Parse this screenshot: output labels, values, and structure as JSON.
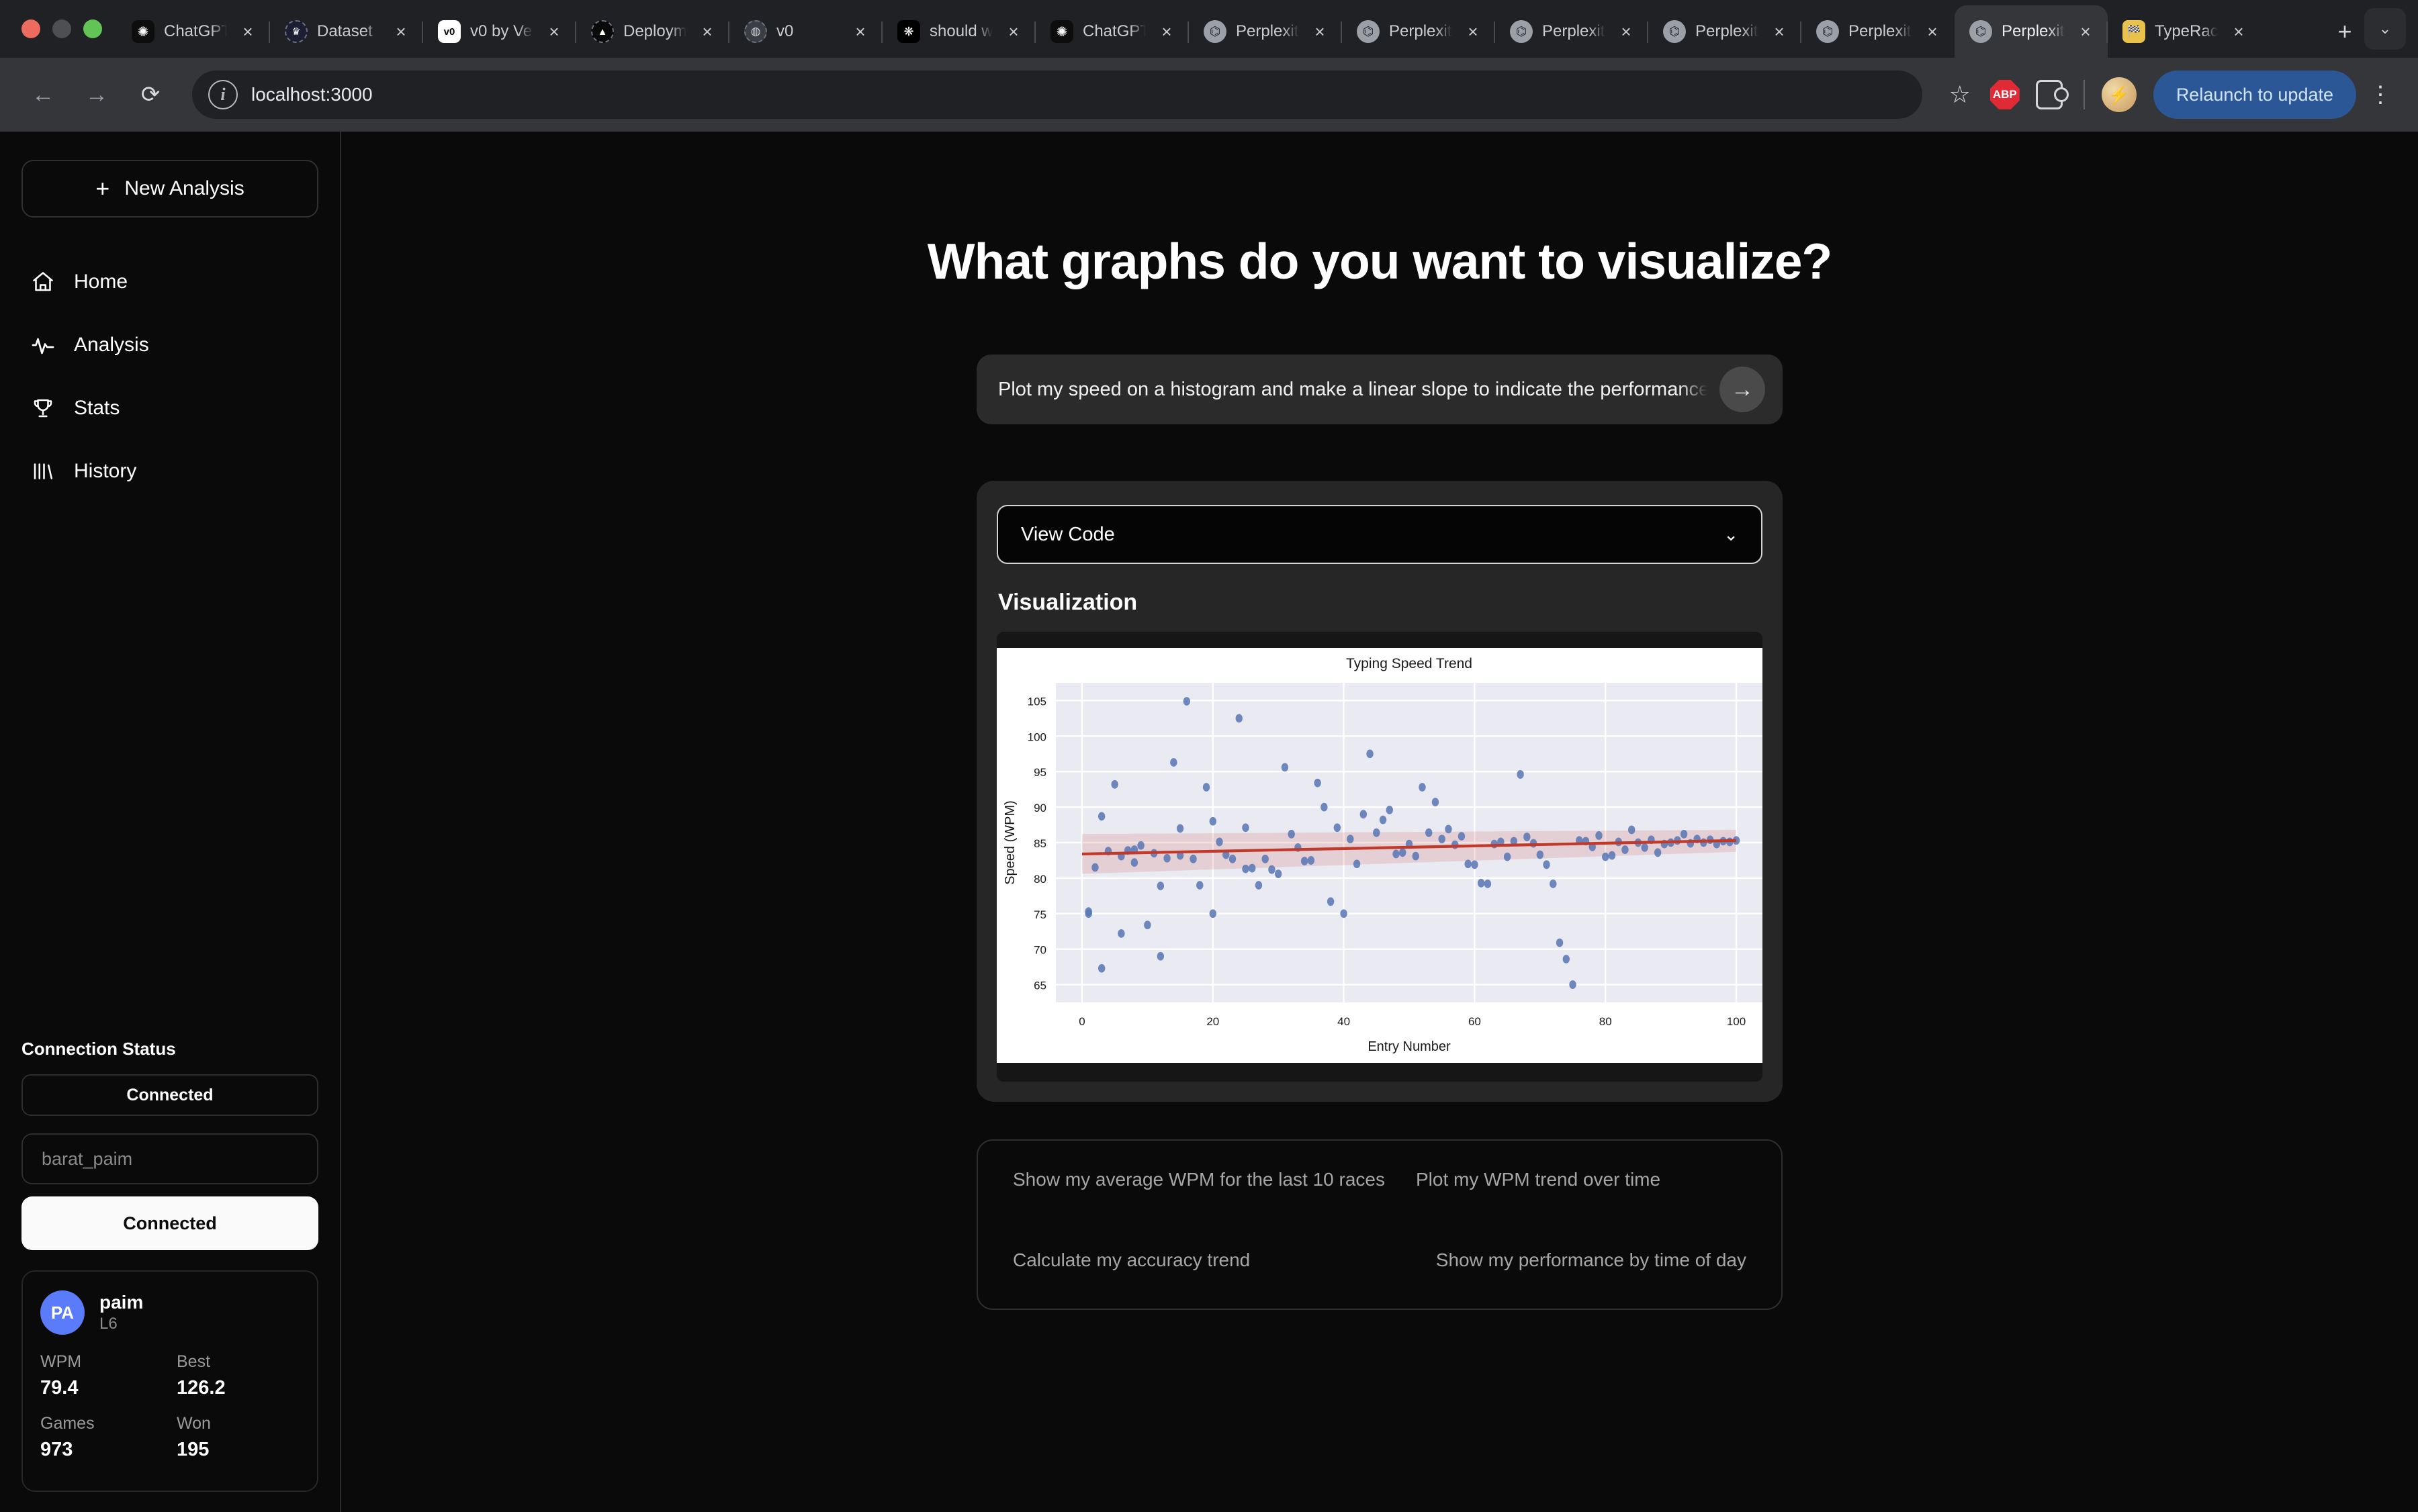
{
  "browser": {
    "tabs": [
      {
        "title": "ChatGPT",
        "favicon": "openai-icon",
        "active": false
      },
      {
        "title": "Dataset",
        "favicon": "crown-icon",
        "active": false
      },
      {
        "title": "v0 by Ve",
        "favicon": "v0-icon",
        "active": false
      },
      {
        "title": "Deploymen",
        "favicon": "vercel-icon",
        "active": false
      },
      {
        "title": "v0",
        "favicon": "globe-icon",
        "active": false
      },
      {
        "title": "should w",
        "favicon": "snowflake-icon",
        "active": false
      },
      {
        "title": "ChatGPT",
        "favicon": "openai-icon",
        "active": false
      },
      {
        "title": "Perplexity",
        "favicon": "perplexity-icon",
        "active": false
      },
      {
        "title": "Perplexity",
        "favicon": "perplexity-icon",
        "active": false
      },
      {
        "title": "Perplexity",
        "favicon": "perplexity-icon",
        "active": false
      },
      {
        "title": "Perplexity",
        "favicon": "perplexity-icon",
        "active": false
      },
      {
        "title": "Perplexity",
        "favicon": "perplexity-icon",
        "active": false
      },
      {
        "title": "Perplexity",
        "favicon": "perplexity-icon",
        "active": true
      },
      {
        "title": "TypeRace",
        "favicon": "typeracer-icon",
        "active": false
      }
    ],
    "new_tab_label": "+",
    "tab_list_label": "⌄",
    "toolbar": {
      "back_label": "←",
      "forward_label": "→",
      "reload_label": "⟳",
      "url": "localhost:3000",
      "site_info_label": "i",
      "bookmark_label": "☆",
      "adblock_label": "ABP",
      "relaunch_label": "Relaunch to update",
      "menu_label": "⋮"
    }
  },
  "sidebar": {
    "new_analysis_label": "New Analysis",
    "items": [
      {
        "label": "Home",
        "icon": "home-icon"
      },
      {
        "label": "Analysis",
        "icon": "activity-pulse-icon"
      },
      {
        "label": "Stats",
        "icon": "trophy-icon"
      },
      {
        "label": "History",
        "icon": "bar-chart-icon"
      }
    ],
    "connection": {
      "title": "Connection Status",
      "status_pill": "Connected",
      "username_placeholder": "barat_paim",
      "connect_button": "Connected"
    },
    "user": {
      "initials": "PA",
      "name": "paim",
      "level": "L6",
      "stats": [
        {
          "key": "WPM",
          "value": "79.4"
        },
        {
          "key": "Best",
          "value": "126.2"
        },
        {
          "key": "Games",
          "value": "973"
        },
        {
          "key": "Won",
          "value": "195"
        }
      ]
    }
  },
  "main": {
    "headline": "What graphs do you want to visualize?",
    "prompt_value": "Plot my speed on a histogram and make a linear slope to indicate the performance t",
    "send_label": "→",
    "view_code_label": "View Code",
    "view_code_chevron": "⌄",
    "visualization_label": "Visualization",
    "suggestions": [
      "Show my average WPM for the last 10 races",
      "Plot my WPM trend over time",
      "Calculate my accuracy trend",
      "Show my performance by time of day"
    ]
  },
  "chart_data": {
    "type": "scatter",
    "title": "Typing Speed Trend",
    "xlabel": "Entry Number",
    "ylabel": "Speed (WPM)",
    "xlim": [
      -4,
      104
    ],
    "ylim": [
      62.5,
      107.5
    ],
    "xticks": [
      0,
      20,
      40,
      60,
      80,
      100
    ],
    "yticks": [
      65,
      70,
      75,
      80,
      85,
      90,
      95,
      100,
      105
    ],
    "grid": true,
    "legend": false,
    "point_color": "#5b79b5",
    "line_color": "#c0392b",
    "band_color": "#c0392b",
    "plot_bg": "#eaeaf2",
    "regression": {
      "x": [
        0,
        100
      ],
      "y": [
        83.4,
        85.3
      ]
    },
    "confidence_band": {
      "x": [
        0,
        100
      ],
      "lower": [
        80.6,
        83.7
      ],
      "upper": [
        86.2,
        86.8
      ]
    },
    "x": [
      1,
      1,
      2,
      3,
      3,
      4,
      5,
      6,
      6,
      7,
      8,
      8,
      9,
      10,
      11,
      12,
      12,
      13,
      14,
      15,
      15,
      16,
      17,
      18,
      19,
      20,
      20,
      21,
      22,
      23,
      24,
      25,
      25,
      26,
      27,
      28,
      29,
      30,
      31,
      32,
      33,
      34,
      35,
      36,
      37,
      38,
      39,
      40,
      41,
      42,
      43,
      44,
      45,
      46,
      47,
      48,
      49,
      50,
      51,
      52,
      53,
      54,
      55,
      56,
      57,
      58,
      59,
      60,
      61,
      62,
      63,
      64,
      65,
      66,
      67,
      68,
      69,
      70,
      71,
      72,
      73,
      74,
      75,
      76,
      77,
      78,
      79,
      80,
      81,
      82,
      83,
      84,
      85,
      86,
      87,
      88,
      89,
      90,
      91,
      92,
      93,
      94,
      95,
      96,
      97,
      98,
      99,
      100
    ],
    "y": [
      75.0,
      75.3,
      81.5,
      67.3,
      88.7,
      83.8,
      93.2,
      83.1,
      72.2,
      83.9,
      84.0,
      82.2,
      84.6,
      73.4,
      83.5,
      78.9,
      69.0,
      82.8,
      96.3,
      87.0,
      83.2,
      104.9,
      82.7,
      79.0,
      92.8,
      75.0,
      88.0,
      85.1,
      83.3,
      82.7,
      102.5,
      87.1,
      81.3,
      81.4,
      79.0,
      82.7,
      81.2,
      80.6,
      95.6,
      86.2,
      84.3,
      82.4,
      82.5,
      93.4,
      90.0,
      76.7,
      87.1,
      75.0,
      85.5,
      82.0,
      89.0,
      97.5,
      86.4,
      88.2,
      89.6,
      83.4,
      83.6,
      84.8,
      83.1,
      92.8,
      86.4,
      90.7,
      85.5,
      86.9,
      84.7,
      85.9,
      82.0,
      81.9,
      79.3,
      79.2,
      84.8,
      85.1,
      83.0,
      85.2,
      94.6,
      85.8,
      84.9,
      83.3,
      81.9,
      79.2,
      70.9,
      68.6,
      65.0,
      85.3,
      85.2,
      84.4,
      86.0,
      83.0,
      83.2,
      85.1,
      84.0,
      86.8,
      85.0,
      84.3,
      85.4,
      83.6,
      84.8,
      85.0,
      85.3,
      86.2,
      84.9,
      85.5,
      85.0,
      85.4,
      84.8,
      85.2,
      85.1,
      85.3
    ]
  }
}
